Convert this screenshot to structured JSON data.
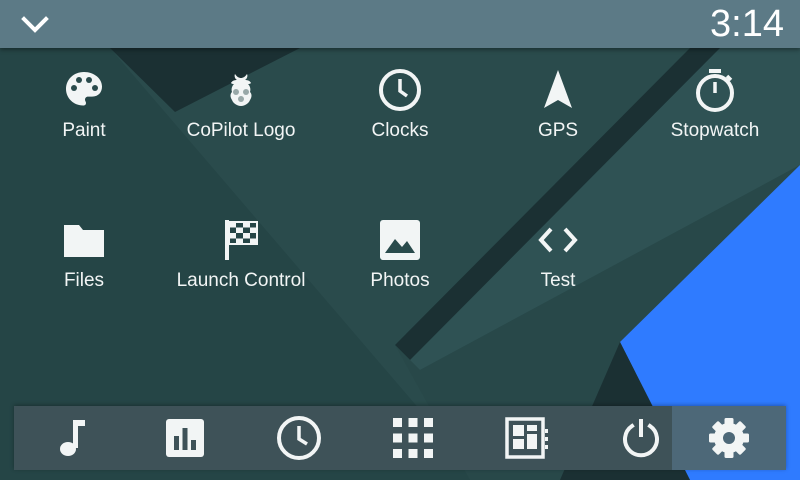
{
  "status_bar": {
    "time": "3:14",
    "menu_icon": "chevron-down-icon"
  },
  "apps": [
    {
      "label": "Paint",
      "icon": "palette-icon"
    },
    {
      "label": "CoPilot Logo",
      "icon": "raspberry-icon"
    },
    {
      "label": "Clocks",
      "icon": "clock-icon"
    },
    {
      "label": "GPS",
      "icon": "navigation-arrow-icon"
    },
    {
      "label": "Stopwatch",
      "icon": "stopwatch-icon"
    },
    {
      "label": "Files",
      "icon": "folder-icon"
    },
    {
      "label": "Launch Control",
      "icon": "checkered-flag-icon"
    },
    {
      "label": "Photos",
      "icon": "image-icon"
    },
    {
      "label": "Test",
      "icon": "code-icon"
    }
  ],
  "dock": {
    "items": [
      {
        "icon": "music-note-icon",
        "active": false
      },
      {
        "icon": "bar-chart-icon",
        "active": false
      },
      {
        "icon": "clock-icon",
        "active": false
      },
      {
        "icon": "app-grid-icon",
        "active": false
      },
      {
        "icon": "dashboard-icon",
        "active": false
      },
      {
        "icon": "power-icon",
        "active": false
      },
      {
        "icon": "gear-icon",
        "active": true
      }
    ]
  },
  "colors": {
    "status_bar": "#5c7a86",
    "background": "#2a4b4c",
    "accent": "#2f7bff",
    "dock": "#3e5258"
  }
}
